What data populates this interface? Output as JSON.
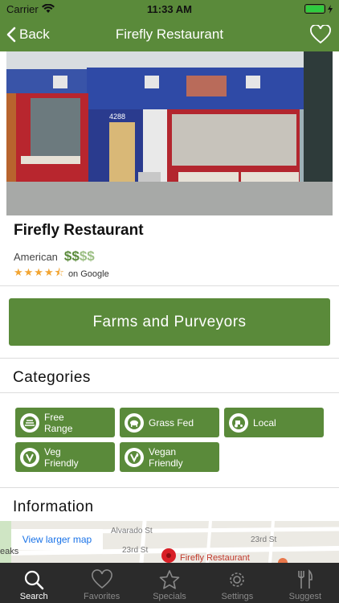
{
  "status_bar": {
    "carrier": "Carrier",
    "time": "11:33 AM"
  },
  "nav": {
    "back_label": "Back",
    "title": "Firefly Restaurant"
  },
  "restaurant": {
    "name": "Firefly Restaurant",
    "cuisine": "American",
    "price_active": "$$",
    "price_inactive": "$$",
    "rating_source": "on Google",
    "rating_value": 4.5,
    "hero_sign_number": "4288"
  },
  "farms_button": "Farms and Purveyors",
  "categories": {
    "heading": "Categories",
    "items": [
      {
        "label": "Free\nRange",
        "icon": "free-range-icon"
      },
      {
        "label": "Grass Fed",
        "icon": "grass-fed-icon"
      },
      {
        "label": "Local",
        "icon": "local-tractor-icon"
      },
      {
        "label": "Veg\nFriendly",
        "icon": "veg-icon"
      },
      {
        "label": "Vegan\nFriendly",
        "icon": "vegan-icon"
      }
    ]
  },
  "information": {
    "heading": "Information",
    "map_link": "View larger map",
    "map_labels": {
      "street1": "Alvarado St",
      "street2": "23rd St",
      "street3": "23rd St",
      "street4": "eaks",
      "pin": "Firefly Restaurant"
    }
  },
  "tabs": [
    {
      "label": "Search",
      "icon": "search-icon",
      "active": true
    },
    {
      "label": "Favorites",
      "icon": "heart-icon",
      "active": false
    },
    {
      "label": "Specials",
      "icon": "star-icon",
      "active": false
    },
    {
      "label": "Settings",
      "icon": "gear-icon",
      "active": false
    },
    {
      "label": "Suggest",
      "icon": "fork-knife-icon",
      "active": false
    }
  ],
  "colors": {
    "brand_green": "#5a8a3a",
    "star": "#f2a533",
    "tabbar": "#2b2b2b"
  }
}
